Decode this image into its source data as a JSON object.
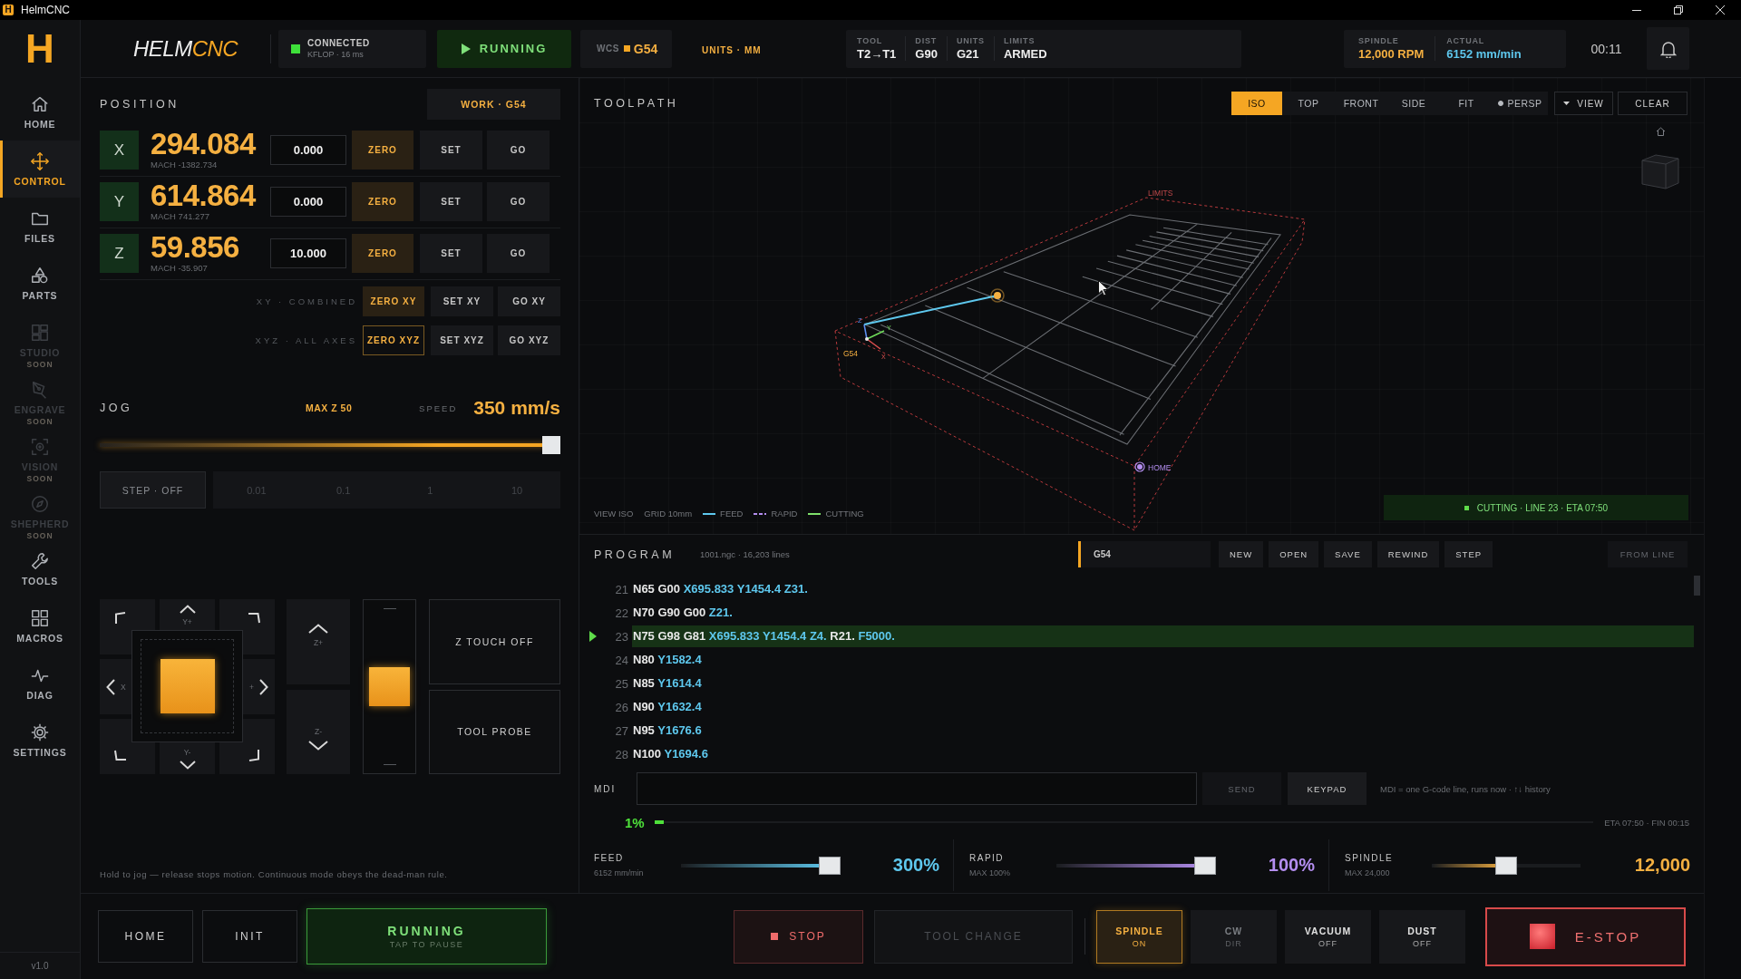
{
  "window": {
    "icon": "H",
    "title": "HelmCNC"
  },
  "header": {
    "logo": "H",
    "brand": {
      "main": "HELM",
      "accent": "CNC"
    },
    "connection": {
      "status": "CONNECTED",
      "detail": "KFLOP · 16 ms",
      "connected": true
    },
    "run_state": {
      "label": "RUNNING",
      "running": true
    },
    "wcs": {
      "label": "WCS",
      "value": "G54"
    },
    "units": "UNITS · MM",
    "modal": [
      {
        "label": "TOOL",
        "value": "T2→T1"
      },
      {
        "label": "DIST",
        "value": "G90"
      },
      {
        "label": "UNITS",
        "value": "G21"
      },
      {
        "label": "LIMITS",
        "value": "ARMED"
      }
    ],
    "readouts": [
      {
        "label": "SPINDLE",
        "value": "12,000 RPM",
        "color": "#f5b041"
      },
      {
        "label": "ACTUAL",
        "value": "6152 mm/min",
        "color": "#5ec8ee"
      }
    ],
    "clock": "00:11"
  },
  "sidebar": {
    "items": [
      {
        "label": "HOME",
        "selected": false,
        "disabled": false
      },
      {
        "label": "CONTROL",
        "selected": true,
        "disabled": false
      },
      {
        "label": "FILES",
        "selected": false,
        "disabled": false
      },
      {
        "label": "PARTS",
        "selected": false,
        "disabled": false
      },
      {
        "label": "STUDIO",
        "selected": false,
        "disabled": true,
        "badge": "SOON"
      },
      {
        "label": "ENGRAVE",
        "selected": false,
        "disabled": true,
        "badge": "SOON"
      },
      {
        "label": "VISION",
        "selected": false,
        "disabled": true,
        "badge": "SOON"
      },
      {
        "label": "SHEPHERD",
        "selected": false,
        "disabled": true,
        "badge": "SOON"
      },
      {
        "label": "TOOLS",
        "selected": false,
        "disabled": false
      },
      {
        "label": "MACROS",
        "selected": false,
        "disabled": false
      },
      {
        "label": "DIAG",
        "selected": false,
        "disabled": false
      },
      {
        "label": "SETTINGS",
        "selected": false,
        "disabled": false
      }
    ],
    "version": "v1.0"
  },
  "position": {
    "title": "POSITION",
    "work": "WORK · G54",
    "axes": [
      {
        "axis": "X",
        "value": "294.084",
        "machine": "MACH -1382.734",
        "input": "0.000",
        "buttons": [
          {
            "label": "ZERO",
            "kind": "accent"
          },
          {
            "label": "SET",
            "kind": "plain"
          },
          {
            "label": "GO",
            "kind": "plain"
          }
        ]
      },
      {
        "axis": "Y",
        "value": "614.864",
        "machine": "MACH 741.277",
        "input": "0.000",
        "buttons": [
          {
            "label": "ZERO",
            "kind": "accent"
          },
          {
            "label": "SET",
            "kind": "plain"
          },
          {
            "label": "GO",
            "kind": "plain"
          }
        ]
      },
      {
        "axis": "Z",
        "value": "59.856",
        "machine": "MACH -35.907",
        "input": "10.000",
        "buttons": [
          {
            "label": "ZERO",
            "kind": "accent"
          },
          {
            "label": "SET",
            "kind": "plain"
          },
          {
            "label": "GO",
            "kind": "plain"
          }
        ]
      }
    ],
    "groups": [
      {
        "label": "XY · COMBINED",
        "buttons": [
          {
            "label": "ZERO XY",
            "kind": "accent"
          },
          {
            "label": "SET XY",
            "kind": "plain"
          },
          {
            "label": "GO XY",
            "kind": "plain"
          }
        ]
      },
      {
        "label": "XYZ · ALL AXES",
        "buttons": [
          {
            "label": "ZERO XYZ",
            "kind": "outline"
          },
          {
            "label": "SET XYZ",
            "kind": "plain"
          },
          {
            "label": "GO XYZ",
            "kind": "plain"
          }
        ]
      }
    ]
  },
  "jog": {
    "title": "JOG",
    "limit": "MAX Z 50",
    "speed_label": "SPEED",
    "speed": "350 mm/s",
    "level": 1,
    "step": {
      "label": "STEP · OFF",
      "on": false
    },
    "increments": [
      {
        "label": "0.01",
        "selected": false
      },
      {
        "label": "0.1",
        "selected": false
      },
      {
        "label": "1",
        "selected": false
      },
      {
        "label": "10",
        "selected": false
      }
    ],
    "pad": {
      "up": "Y+",
      "left": "X",
      "right": "+",
      "down": "Y-"
    },
    "z_up": "Z+",
    "z_down": "Z-",
    "z_slider": {
      "level": 0.5
    },
    "probes": [
      "Z TOUCH OFF",
      "TOOL PROBE"
    ],
    "hint": "Hold to jog — release stops motion. Continuous mode obeys the dead-man rule."
  },
  "machine_bar": {
    "buttons": [
      "HOME",
      "INIT"
    ],
    "run": {
      "label": "RUNNING",
      "sub": "TAP TO PAUSE",
      "running": true
    }
  },
  "toolpath": {
    "title": "TOOLPATH",
    "views": [
      {
        "label": "ISO",
        "selected": true
      },
      {
        "label": "TOP",
        "selected": false
      },
      {
        "label": "FRONT",
        "selected": false
      },
      {
        "label": "SIDE",
        "selected": false
      }
    ],
    "fit": "FIT",
    "perspective": {
      "label": "PERSP",
      "on": true
    },
    "view_menu": "VIEW",
    "clear": "CLEAR",
    "scene": {
      "limits": "LIMITS",
      "origin": "G54",
      "home": "HOME",
      "axes": [
        "Z",
        "Y",
        "X"
      ]
    },
    "legend": {
      "view": "VIEW ISO",
      "grid": "GRID 10mm",
      "lines": [
        {
          "label": "FEED",
          "kind": "solid",
          "color": "#5ec8ee"
        },
        {
          "label": "RAPID",
          "kind": "dashed",
          "color": "#b48ef0"
        },
        {
          "label": "CUTTING",
          "kind": "solid",
          "color": "#7ee06a"
        }
      ]
    },
    "status": "CUTTING · LINE 23 · ETA 07:50"
  },
  "program": {
    "title": "PROGRAM",
    "file": "1001.ngc · 16,203 lines",
    "wcs": "G54",
    "actions": [
      {
        "label": "NEW",
        "disabled": false
      },
      {
        "label": "OPEN",
        "disabled": false
      },
      {
        "label": "SAVE",
        "disabled": false
      },
      {
        "label": "REWIND",
        "disabled": false
      },
      {
        "label": "STEP",
        "disabled": false
      }
    ],
    "from_line": {
      "label": "FROM LINE",
      "disabled": true
    },
    "lines": [
      {
        "number": "21",
        "current": false,
        "code": [
          {
            "text": "N65 G00",
            "kind": "word"
          },
          {
            "text": "X695.833 Y1454.4 Z31.",
            "kind": "coord"
          }
        ]
      },
      {
        "number": "22",
        "current": false,
        "code": [
          {
            "text": "N70 G90 G00",
            "kind": "word"
          },
          {
            "text": "Z21.",
            "kind": "coord"
          }
        ]
      },
      {
        "number": "23",
        "current": true,
        "code": [
          {
            "text": "N75 G98 G81",
            "kind": "word"
          },
          {
            "text": "X695.833 Y1454.4 Z4.",
            "kind": "coord"
          },
          {
            "text": "R21.",
            "kind": "word"
          },
          {
            "text": "F5000.",
            "kind": "coord"
          }
        ]
      },
      {
        "number": "24",
        "current": false,
        "code": [
          {
            "text": "N80",
            "kind": "word"
          },
          {
            "text": "Y1582.4",
            "kind": "coord"
          }
        ]
      },
      {
        "number": "25",
        "current": false,
        "code": [
          {
            "text": "N85",
            "kind": "word"
          },
          {
            "text": "Y1614.4",
            "kind": "coord"
          }
        ]
      },
      {
        "number": "26",
        "current": false,
        "code": [
          {
            "text": "N90",
            "kind": "word"
          },
          {
            "text": "Y1632.4",
            "kind": "coord"
          }
        ]
      },
      {
        "number": "27",
        "current": false,
        "code": [
          {
            "text": "N95",
            "kind": "word"
          },
          {
            "text": "Y1676.6",
            "kind": "coord"
          }
        ]
      },
      {
        "number": "28",
        "current": false,
        "code": [
          {
            "text": "N100",
            "kind": "word"
          },
          {
            "text": "Y1694.6",
            "kind": "coord"
          }
        ]
      }
    ],
    "mdi": {
      "label": "MDI",
      "send": {
        "label": "SEND",
        "disabled": true
      },
      "keypad": "KEYPAD",
      "hint": "MDI = one G-code line, runs now · ↑↓ history"
    },
    "progress": {
      "percent": "1%",
      "level": 0.01,
      "eta": "ETA 07:50 · FIN 00:15"
    }
  },
  "overrides": [
    {
      "label": "FEED",
      "detail": "6152 mm/min",
      "level": 1,
      "value": "300%",
      "color": "#5ec8ee"
    },
    {
      "label": "RAPID",
      "detail": "MAX 100%",
      "level": 1,
      "value": "100%",
      "color": "#b48ef0"
    },
    {
      "label": "SPINDLE",
      "detail": "MAX 24,000",
      "level": 0.5,
      "value": "12,000",
      "color": "#f5b041"
    }
  ],
  "controls": {
    "stop": "STOP",
    "tool_change": {
      "label": "TOOL CHANGE",
      "disabled": true
    },
    "toggles": [
      {
        "label": "SPINDLE",
        "sub": "ON",
        "on": true,
        "disabled": false
      },
      {
        "label": "CW",
        "sub": "DIR",
        "on": false,
        "disabled": true
      },
      {
        "label": "VACUUM",
        "sub": "OFF",
        "on": false,
        "disabled": false
      },
      {
        "label": "DUST",
        "sub": "OFF",
        "on": false,
        "disabled": false
      }
    ],
    "estop": "E-STOP"
  }
}
